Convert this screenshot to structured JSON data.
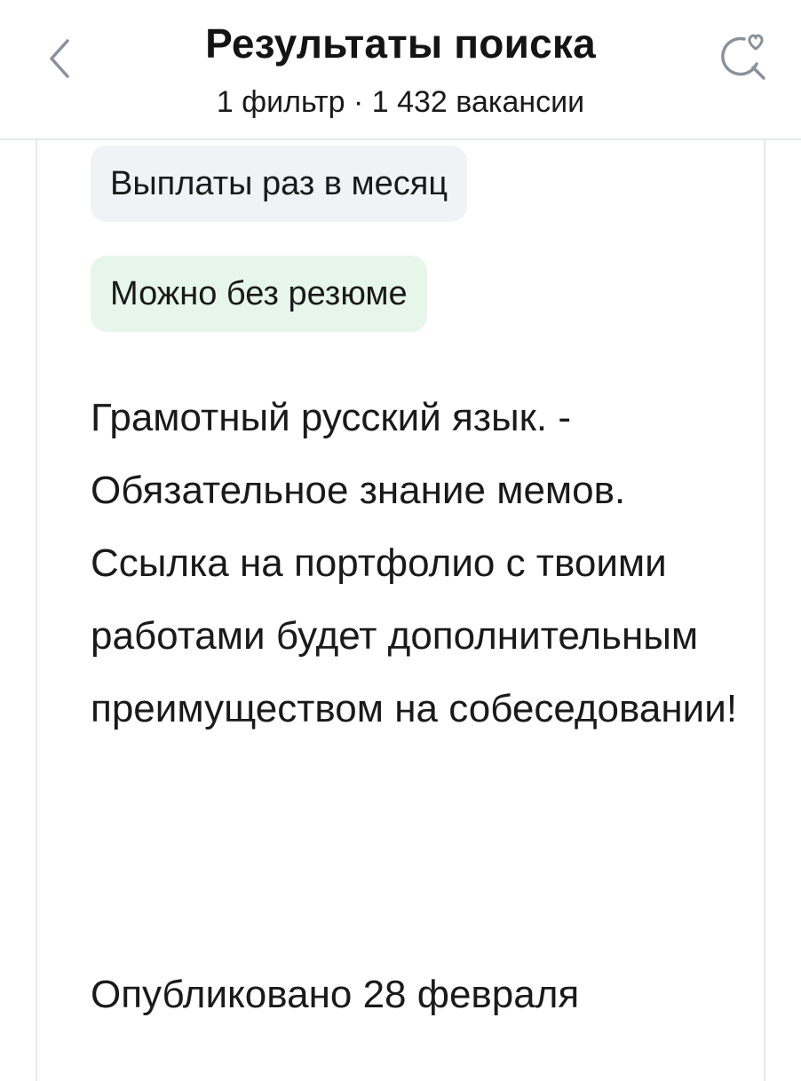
{
  "header": {
    "title": "Результаты поиска",
    "subtitle": "1 фильтр · 1 432 вакансии",
    "back_icon": "chevron-left-icon",
    "save_icon": "search-heart-icon"
  },
  "vacancy": {
    "tags": [
      {
        "label": "Выплаты раз в месяц",
        "style": "gray"
      },
      {
        "label": "Можно без резюме",
        "style": "green"
      }
    ],
    "description": "Грамотный русский язык. - Обязательное знание мемов. Ссылка на портфолио с твоими работами будет дополнительным преимуществом на собеседовании!",
    "published": "Опубликовано 28 февраля"
  },
  "colors": {
    "divider": "#e6e9ee",
    "tag_gray_bg": "#f0f2f6",
    "tag_green_bg": "#e7f6eb",
    "icon": "#8a919c"
  }
}
